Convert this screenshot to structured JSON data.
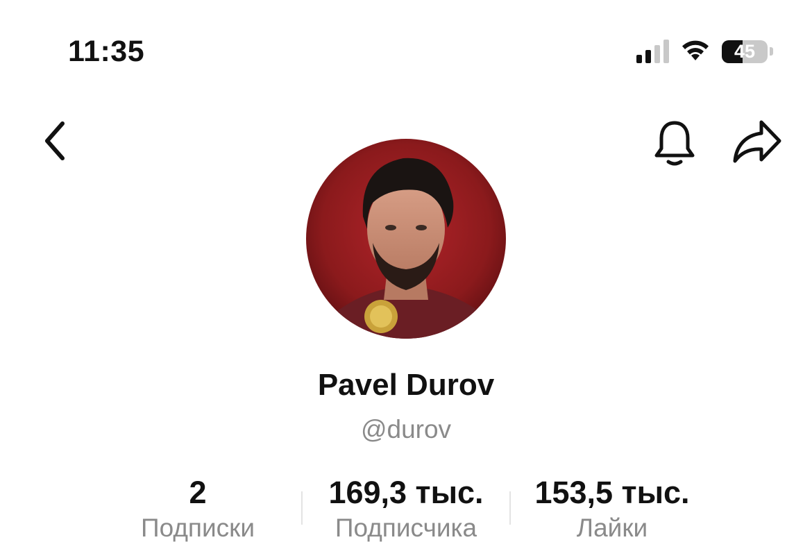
{
  "status_bar": {
    "time": "11:35",
    "battery_percent": "45",
    "signal_bars_active": 2,
    "signal_bars_total": 4
  },
  "header": {
    "back_icon": "chevron-left-icon",
    "notification_icon": "bell-icon",
    "share_icon": "share-arrow-icon"
  },
  "profile": {
    "name": "Pavel Durov",
    "username": "@durov",
    "avatar_icon": "profile-photo",
    "avatar_background": "#8b1a1c"
  },
  "stats": [
    {
      "value": "2",
      "label": "Подписки"
    },
    {
      "value": "169,3 тыс.",
      "label": "Подписчика"
    },
    {
      "value": "153,5 тыс.",
      "label": "Лайки"
    }
  ],
  "colors": {
    "text_primary": "#111111",
    "text_secondary": "#8a8a8a",
    "background": "#ffffff"
  }
}
